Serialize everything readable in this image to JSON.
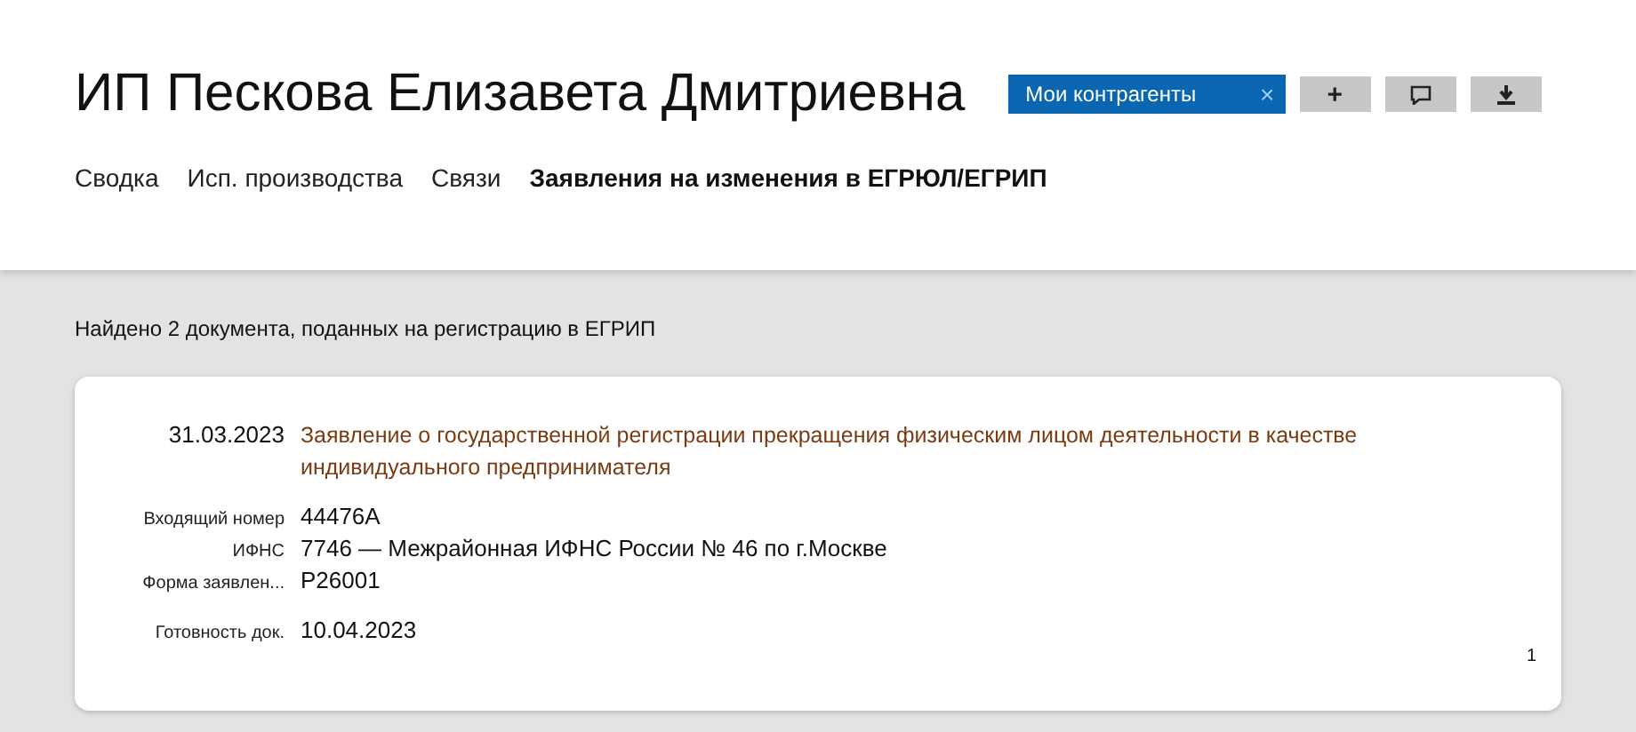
{
  "title": "ИП Пескова Елизавета Дмитриевна",
  "tag": {
    "label": "Мои контрагенты",
    "close": "×"
  },
  "actions": [
    {
      "kind": "add",
      "label": "+"
    },
    {
      "kind": "comment"
    },
    {
      "kind": "download"
    }
  ],
  "tabs": [
    {
      "label": "Сводка",
      "selected": false
    },
    {
      "label": "Исп. производства",
      "selected": false
    },
    {
      "label": "Связи",
      "selected": false
    },
    {
      "label": "Заявления на изменения в ЕГРЮЛ/ЕГРИП",
      "selected": true
    }
  ],
  "summary": "Найдено 2 документа, поданных на регистрацию в ЕГРИП",
  "document": {
    "date": "31.03.2023",
    "title": "Заявление о государственной регистрации прекращения физическим лицом деятельности в качестве индивидуального предпринимателя",
    "fields": [
      {
        "label": "Входящий номер",
        "value": "44476А"
      },
      {
        "label": "ИФНС",
        "value": "7746 — Межрайонная ИФНС России № 46 по г.Москве"
      },
      {
        "label": "Форма заявлен...",
        "value": "Р26001"
      },
      {
        "label": "Готовность док.",
        "value": "10.04.2023"
      }
    ],
    "page": "1"
  }
}
